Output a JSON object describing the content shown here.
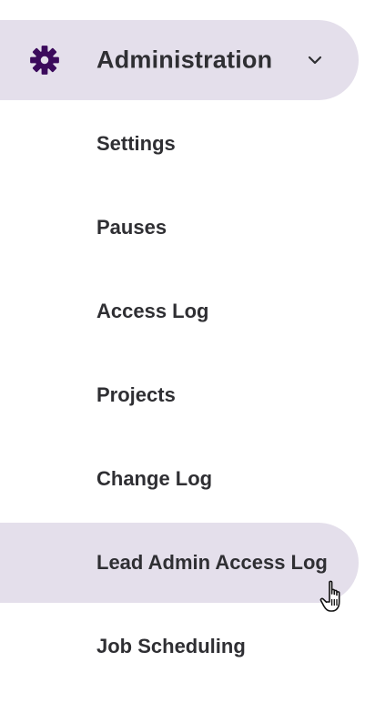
{
  "nav": {
    "section": {
      "label": "Administration",
      "icon": "gear-icon",
      "expanded": true,
      "icon_color": "#3b0a5c",
      "highlight_color": "#e4dfeb"
    },
    "items": [
      {
        "label": "Settings"
      },
      {
        "label": "Pauses"
      },
      {
        "label": "Access Log"
      },
      {
        "label": "Projects"
      },
      {
        "label": "Change Log"
      },
      {
        "label": "Lead Admin Access Log"
      },
      {
        "label": "Job Scheduling"
      }
    ],
    "hovered_item": "Lead Admin Access Log"
  }
}
